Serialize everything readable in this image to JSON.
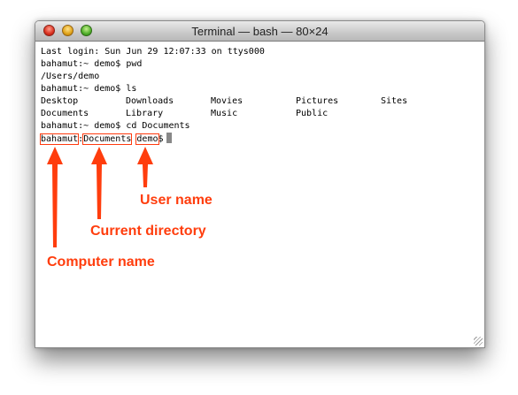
{
  "window": {
    "title": "Terminal — bash — 80×24"
  },
  "terminal": {
    "lines": [
      "Last login: Sun Jun 29 12:07:33 on ttys000",
      "bahamut:~ demo$ pwd",
      "/Users/demo",
      "bahamut:~ demo$ ls"
    ],
    "ls_rows": [
      [
        "Desktop",
        "Downloads",
        "Movies",
        "Pictures",
        "Sites"
      ],
      [
        "Documents",
        "Library",
        "Music",
        "Public"
      ]
    ],
    "cd_line": "bahamut:~ demo$ cd Documents",
    "prompt": {
      "computer": "bahamut",
      "sep1": ":",
      "directory": "Documents",
      "sep2": " ",
      "user": "demo",
      "symbol": "$"
    }
  },
  "annotations": {
    "user_name": "User name",
    "current_directory": "Current directory",
    "computer_name": "Computer name"
  },
  "colors": {
    "annotation": "#ff3d0d"
  }
}
